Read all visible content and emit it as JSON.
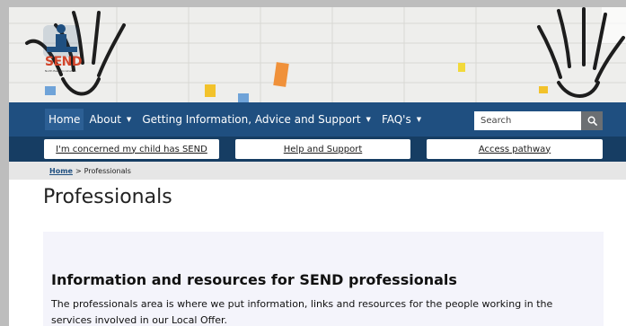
{
  "logo": {
    "text": "SEND",
    "subtitle": "North East Lincolnshire"
  },
  "nav": {
    "items": [
      {
        "label": "Home",
        "caret": false
      },
      {
        "label": "About",
        "caret": true
      },
      {
        "label": "Getting Information, Advice and Support",
        "caret": true
      },
      {
        "label": "FAQ's",
        "caret": true
      }
    ],
    "search_placeholder": "Search"
  },
  "quick_links": [
    {
      "label": "I'm concerned my child has SEND"
    },
    {
      "label": "Help and Support"
    },
    {
      "label": "Access pathway"
    }
  ],
  "breadcrumb": {
    "home": "Home",
    "separator": ">",
    "current": "Professionals"
  },
  "page_title": "Professionals",
  "panel": {
    "heading": "Information and resources for SEND professionals",
    "text": "The professionals area is where we put information, links and resources for the people working in the services involved in our Local Offer."
  },
  "colors": {
    "nav": "#1f4f80",
    "quick_bar": "#163d63",
    "logo": "#d2452b",
    "panel": "#f4f4fb"
  }
}
